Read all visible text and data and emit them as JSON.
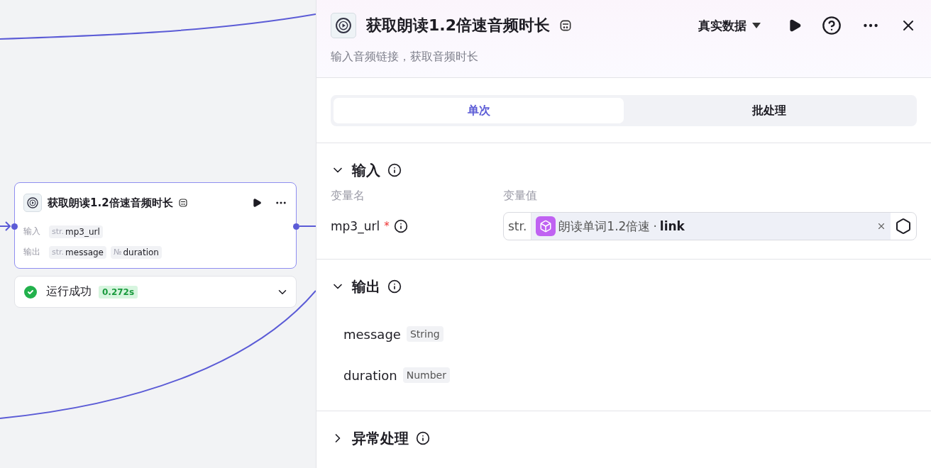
{
  "canvas": {
    "node": {
      "title": "获取朗读1.2倍速音频时长",
      "input_label": "输入",
      "inputs": [
        {
          "type": "str.",
          "name": "mp3_url"
        }
      ],
      "output_label": "输出",
      "outputs": [
        {
          "type": "str.",
          "name": "message"
        },
        {
          "type": "№",
          "name": "duration"
        }
      ],
      "status": {
        "text": "运行成功",
        "time": "0.272s"
      }
    }
  },
  "panel": {
    "title": "获取朗读1.2倍速音频时长",
    "description": "输入音频链接，获取音频时长",
    "data_mode": "真实数据",
    "tabs": [
      {
        "label": "单次",
        "selected": true
      },
      {
        "label": "批处理",
        "selected": false
      }
    ],
    "input_section": {
      "title": "输入",
      "expanded": true,
      "col_name": "变量名",
      "col_value": "变量值",
      "params": [
        {
          "name": "mp3_url",
          "required": true,
          "required_mark": "*",
          "type": "str.",
          "source": "朗读单词1.2倍速",
          "separator": "·",
          "field": "link"
        }
      ]
    },
    "output_section": {
      "title": "输出",
      "expanded": true,
      "fields": [
        {
          "name": "message",
          "type": "String"
        },
        {
          "name": "duration",
          "type": "Number"
        }
      ]
    },
    "error_section": {
      "title": "异常处理",
      "expanded": false
    }
  }
}
